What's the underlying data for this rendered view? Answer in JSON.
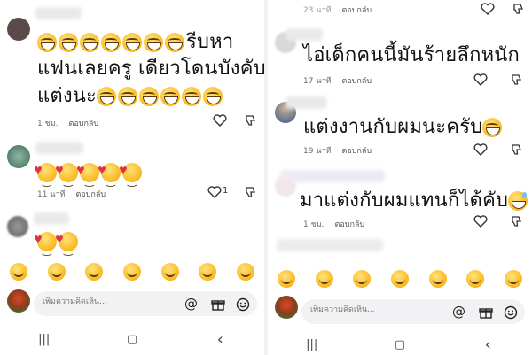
{
  "left": {
    "comments": [
      {
        "text_line1": "รีบหา",
        "text_line2": "แฟนเลยครู เดียวโดนบังคับ",
        "text_line3": "แต่งนะ",
        "time": "1 ชม.",
        "reply": "ตอบกลับ"
      },
      {
        "time": "11 นาที",
        "reply": "ตอบกลับ",
        "likes": "1"
      },
      {}
    ]
  },
  "right": {
    "top_meta": {
      "time": "23 นาที",
      "reply": "ตอบกลับ"
    },
    "comments": [
      {
        "text": "ไอ่เด็กคนนี้มันร้ายลึกหนัก",
        "time": "17 นาที",
        "reply": "ตอบกลับ"
      },
      {
        "text": "แต่งงานกับผมนะครับ",
        "time": "19 นาที",
        "reply": "ตอบกลับ"
      },
      {
        "text": "มาแต่งกับผมแทนก็ได้คับ",
        "time": "1 ชม.",
        "reply": "ตอบกลับ"
      }
    ]
  },
  "composer": {
    "placeholder": "เพิ่มความคิดเห็น...",
    "mention_icon": "at-icon",
    "gift_icon": "gift-icon",
    "emoji_icon": "emoji-icon"
  },
  "navbar": {
    "recent_glyph": "|||",
    "home_glyph": "▢",
    "back_glyph": "‹"
  },
  "icons": [
    "heart-icon",
    "dislike-icon",
    "at-icon",
    "gift-icon",
    "emoji-icon"
  ],
  "colors": {
    "emoji_yellow": "#f9b81d",
    "heart_red": "#e23140",
    "meta_gray": "#6b6b6b",
    "input_bg": "#f2f2f4"
  }
}
